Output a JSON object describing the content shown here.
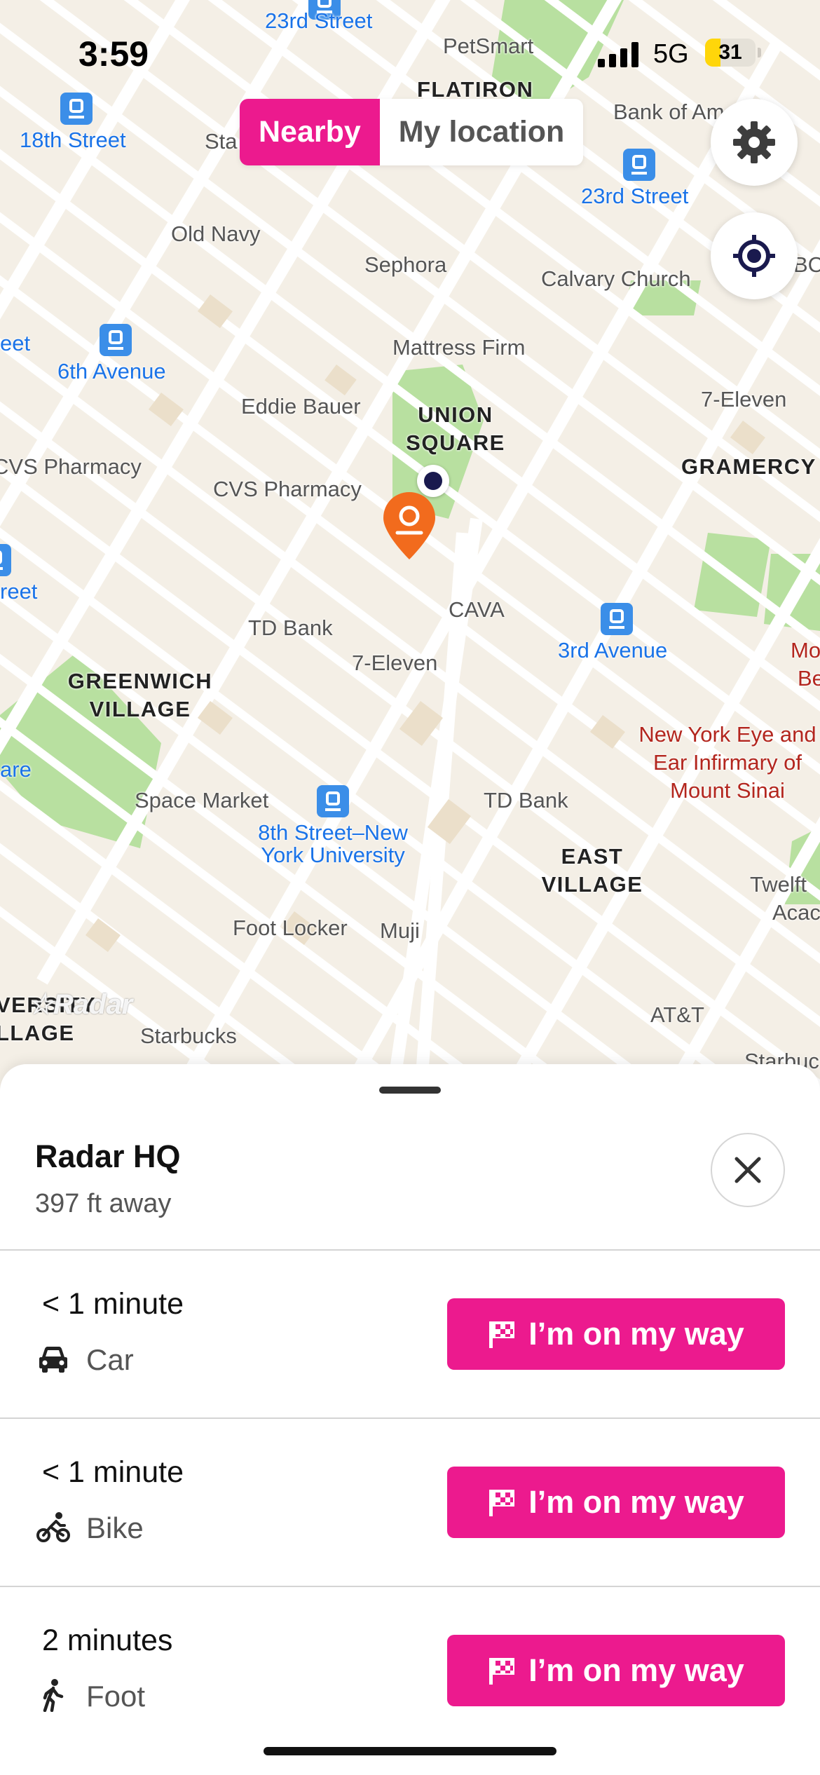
{
  "status_bar": {
    "time": "3:59",
    "network": "5G",
    "battery": "31",
    "battery_level": 0.31
  },
  "segmented": {
    "options": [
      "Nearby",
      "My location"
    ],
    "selected": "Nearby"
  },
  "map": {
    "neighborhoods": [
      "FLATIRON",
      "UNION SQUARE",
      "GRAMERCY",
      "GREENWICH VILLAGE",
      "EAST VILLAGE",
      "VERSITY LLAGE"
    ],
    "places": [
      "PetSmart",
      "Bank of Am",
      "Old Navy",
      "Sephora",
      "Calvary Church",
      "Mattress Firm",
      "7-Eleven",
      "Eddie Bauer",
      "CVS Pharmacy",
      "CVS Pharmacy",
      "CAVA",
      "TD Bank",
      "7-Eleven",
      "Mo",
      "Be",
      "Space Market",
      "TD Bank",
      "Twelft",
      "Acac",
      "Foot Locker",
      "Muji",
      "AT&T",
      "Starbucks",
      "Starbuc",
      "Sta",
      "BC"
    ],
    "hospital": "New York Eye and Ear Infirmary of Mount Sinai",
    "transit": [
      "23rd Street",
      "18th Street",
      "23rd Street",
      "6th Avenue",
      "3rd Avenue",
      "8th Street–New York University",
      "eet",
      "reet",
      "are"
    ],
    "watermark": "Radar"
  },
  "destination": {
    "name": "Radar HQ",
    "distance": "397 ft away"
  },
  "travel_options": [
    {
      "duration": "< 1 minute",
      "mode": "Car",
      "icon": "car-icon",
      "button": "I’m on my way"
    },
    {
      "duration": "< 1 minute",
      "mode": "Bike",
      "icon": "bike-icon",
      "button": "I’m on my way"
    },
    {
      "duration": "2 minutes",
      "mode": "Foot",
      "icon": "walk-icon",
      "button": "I’m on my way"
    }
  ],
  "colors": {
    "accent": "#ec1a8e",
    "pin": "#f26b1d",
    "user_dot": "#1a1a4e",
    "transit": "#1a73e8",
    "park": "#b8e0a0"
  }
}
